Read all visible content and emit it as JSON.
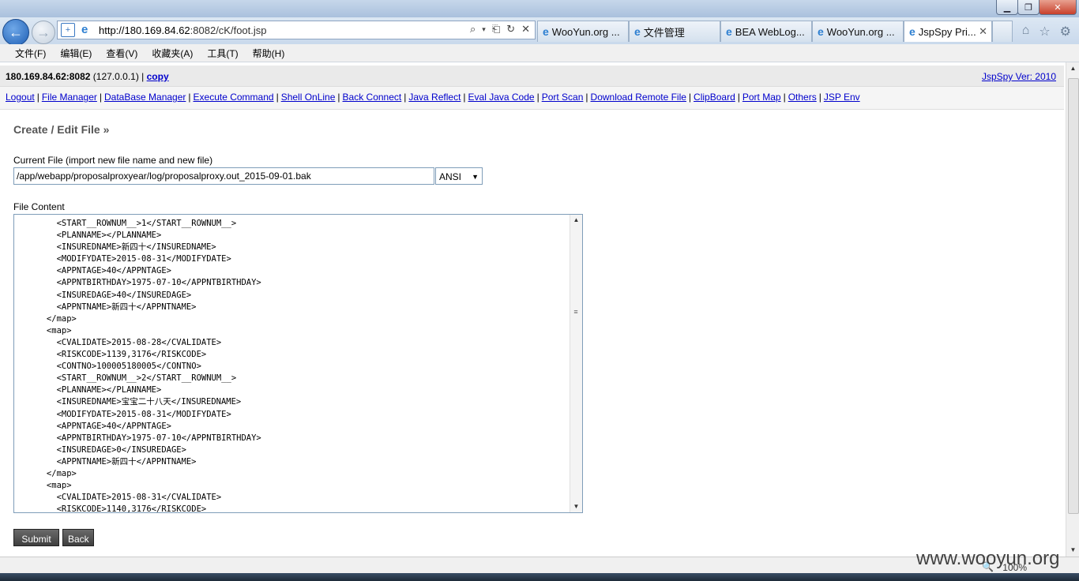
{
  "browser": {
    "window_controls": {
      "minimize": "▁",
      "maximize": "❐",
      "close": "✕"
    },
    "address": {
      "host": "http://180.169.84.62",
      "rest": ":8082/cK/foot.jsp"
    },
    "tabs": [
      {
        "label": "WooYun.org ..."
      },
      {
        "label": "文件管理"
      },
      {
        "label": "BEA WebLog..."
      },
      {
        "label": "WooYun.org ..."
      },
      {
        "label": "JspSpy Pri..."
      }
    ],
    "menu": [
      "文件(F)",
      "编辑(E)",
      "查看(V)",
      "收藏夹(A)",
      "工具(T)",
      "帮助(H)"
    ],
    "zoom": "100%"
  },
  "header": {
    "host": "180.169.84.62:8082",
    "local": "(127.0.0.1) |",
    "copy_link": "copy",
    "version": "JspSpy Ver: 2010"
  },
  "nav_links": [
    "Logout",
    "File Manager",
    "DataBase Manager",
    "Execute Command",
    "Shell OnLine",
    "Back Connect",
    "Java Reflect",
    "Eval Java Code",
    "Port Scan",
    "Download Remote File",
    "ClipBoard",
    "Port Map",
    "Others",
    "JSP Env"
  ],
  "form": {
    "title": "Create / Edit File",
    "title_suffix": "»",
    "current_file_label": "Current File (import new file name and new file)",
    "current_file_value": "/app/webapp/proposalproxyear/log/proposalproxy.out_2015-09-01.bak",
    "encoding": "ANSI",
    "content_label": "File Content",
    "content_lines": [
      "        <START__ROWNUM__>1</START__ROWNUM__>",
      "        <PLANNAME></PLANNAME>",
      "        <INSUREDNAME>新四十</INSUREDNAME>",
      "        <MODIFYDATE>2015-08-31</MODIFYDATE>",
      "        <APPNTAGE>40</APPNTAGE>",
      "        <APPNTBIRTHDAY>1975-07-10</APPNTBIRTHDAY>",
      "        <INSUREDAGE>40</INSUREDAGE>",
      "        <APPNTNAME>新四十</APPNTNAME>",
      "      </map>",
      "      <map>",
      "        <CVALIDATE>2015-08-28</CVALIDATE>",
      "        <RISKCODE>1139,3176</RISKCODE>",
      "        <CONTNO>100005180005</CONTNO>",
      "        <START__ROWNUM__>2</START__ROWNUM__>",
      "        <PLANNAME></PLANNAME>",
      "        <INSUREDNAME>宝宝二十八天</INSUREDNAME>",
      "        <MODIFYDATE>2015-08-31</MODIFYDATE>",
      "        <APPNTAGE>40</APPNTAGE>",
      "        <APPNTBIRTHDAY>1975-07-10</APPNTBIRTHDAY>",
      "        <INSUREDAGE>0</INSUREDAGE>",
      "        <APPNTNAME>新四十</APPNTNAME>",
      "      </map>",
      "      <map>",
      "        <CVALIDATE>2015-08-31</CVALIDATE>",
      "        <RISKCODE>1140,3176</RISKCODE>"
    ],
    "submit_label": "Submit",
    "back_label": "Back"
  },
  "watermark": "www.wooyun.org",
  "colors": {
    "link": "#0000cc",
    "header_bg": "#eaeaea",
    "button_bg": "#4a4a4a"
  }
}
